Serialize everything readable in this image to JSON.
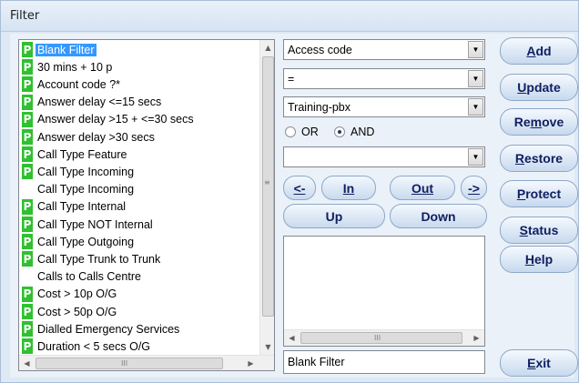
{
  "window": {
    "title": "Filter"
  },
  "list": {
    "items": [
      {
        "label": "Blank Filter",
        "has_p": true,
        "selected": true
      },
      {
        "label": "30 mins + 10 p",
        "has_p": true,
        "selected": false
      },
      {
        "label": "Account code ?*",
        "has_p": true,
        "selected": false
      },
      {
        "label": "Answer delay <=15 secs",
        "has_p": true,
        "selected": false
      },
      {
        "label": "Answer delay >15 + <=30 secs",
        "has_p": true,
        "selected": false
      },
      {
        "label": "Answer delay >30 secs",
        "has_p": true,
        "selected": false
      },
      {
        "label": "Call Type Feature",
        "has_p": true,
        "selected": false
      },
      {
        "label": "Call Type Incoming",
        "has_p": true,
        "selected": false
      },
      {
        "label": "Call Type Incoming",
        "has_p": false,
        "selected": false
      },
      {
        "label": "Call Type Internal",
        "has_p": true,
        "selected": false
      },
      {
        "label": "Call Type NOT Internal",
        "has_p": true,
        "selected": false
      },
      {
        "label": "Call Type Outgoing",
        "has_p": true,
        "selected": false
      },
      {
        "label": "Call Type Trunk to Trunk",
        "has_p": true,
        "selected": false
      },
      {
        "label": "Calls to Calls Centre",
        "has_p": false,
        "selected": false
      },
      {
        "label": "Cost > 10p O/G",
        "has_p": true,
        "selected": false
      },
      {
        "label": "Cost > 50p O/G",
        "has_p": true,
        "selected": false
      },
      {
        "label": "Dialled Emergency Services",
        "has_p": true,
        "selected": false
      },
      {
        "label": "Duration < 5 secs O/G",
        "has_p": true,
        "selected": false
      }
    ],
    "p_badge": "P"
  },
  "middle": {
    "field_combo": "Access code",
    "operator_combo": "=",
    "value_combo": "Training-pbx",
    "radio_or": "OR",
    "radio_and": "AND",
    "radio_selected": "AND",
    "extra_combo": "",
    "btn_left": "<-",
    "btn_in": "In",
    "btn_out": "Out",
    "btn_right": "->",
    "btn_up": "Up",
    "btn_down": "Down",
    "filter_name": "Blank Filter"
  },
  "side": {
    "add": {
      "pre": "",
      "key": "A",
      "post": "dd"
    },
    "update": {
      "pre": "",
      "key": "U",
      "post": "pdate"
    },
    "remove": {
      "pre": "Re",
      "key": "m",
      "post": "ove"
    },
    "restore": {
      "pre": "",
      "key": "R",
      "post": "estore"
    },
    "protect": {
      "pre": "",
      "key": "P",
      "post": "rotect"
    },
    "status": {
      "pre": "",
      "key": "S",
      "post": "tatus"
    },
    "help": {
      "pre": "",
      "key": "H",
      "post": "elp"
    },
    "exit": {
      "pre": "",
      "key": "E",
      "post": "xit"
    }
  },
  "icons": {
    "scroll_up": "▲",
    "scroll_down": "▼",
    "scroll_left": "◀",
    "scroll_right": "▶",
    "combo_arrow": "▼",
    "grip_h": "III",
    "grip_v": "≡"
  }
}
